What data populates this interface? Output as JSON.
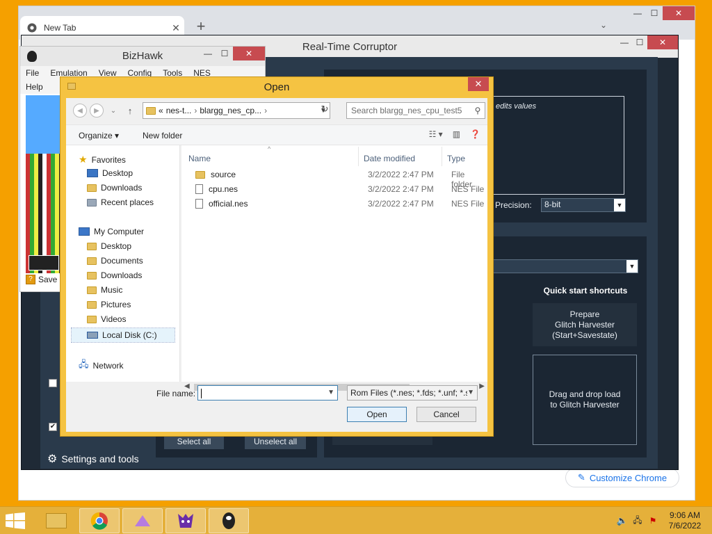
{
  "chrome": {
    "tab_title": "New Tab",
    "customize_label": "Customize Chrome"
  },
  "rtc": {
    "title": "Real-Time Corruptor",
    "edits_text": "edits values",
    "precision_label": "e Precision:",
    "precision_value": "8-bit",
    "quick_start": "Quick start shortcuts",
    "prepare_line1": "Prepare",
    "prepare_line2": "Glitch Harvester",
    "prepare_line3": "(Start+Savestate)",
    "drag_line1": "Drag and drop load",
    "drag_line2": "to Glitch Harvester",
    "select_all": "Select all",
    "unselect_all": "Unselect all",
    "settings": "Settings and tools"
  },
  "bizhawk": {
    "title": "BizHawk",
    "menu_row1": [
      "File",
      "Emulation",
      "View",
      "Config",
      "Tools",
      "NES"
    ],
    "menu_row2": [
      "Help"
    ],
    "status": "Save"
  },
  "dialog": {
    "title": "Open",
    "path_prefix": "«",
    "path_parts": [
      "nes-t...",
      "blargg_nes_cp..."
    ],
    "search_placeholder": "Search blargg_nes_cpu_test5",
    "organize": "Organize",
    "new_folder": "New folder",
    "nav": {
      "favorites": "Favorites",
      "fav_items": [
        "Desktop",
        "Downloads",
        "Recent places"
      ],
      "computer": "My Computer",
      "computer_items": [
        "Desktop",
        "Documents",
        "Downloads",
        "Music",
        "Pictures",
        "Videos",
        "Local Disk (C:)"
      ],
      "network": "Network"
    },
    "columns": {
      "name": "Name",
      "date": "Date modified",
      "type": "Type"
    },
    "files": [
      {
        "name": "source",
        "date": "3/2/2022 2:47 PM",
        "type": "File folder",
        "kind": "folder"
      },
      {
        "name": "cpu.nes",
        "date": "3/2/2022 2:47 PM",
        "type": "NES File",
        "kind": "file"
      },
      {
        "name": "official.nes",
        "date": "3/2/2022 2:47 PM",
        "type": "NES File",
        "kind": "file"
      }
    ],
    "file_name_label": "File name:",
    "file_name_value": "",
    "file_type": "Rom Files (*.nes; *.fds; *.unf; *.s",
    "open_btn": "Open",
    "cancel_btn": "Cancel"
  },
  "taskbar": {
    "time": "9:06 AM",
    "date": "7/6/2022"
  }
}
